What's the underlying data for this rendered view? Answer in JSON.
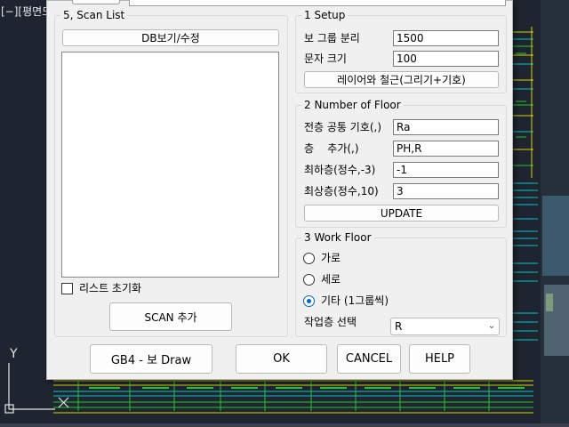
{
  "cad": {
    "viewport_label": "[−][평면도",
    "ucs_axis_label": "Y"
  },
  "scan": {
    "title": "5, Scan  List",
    "db_button": "DB보기/수정",
    "reset_checkbox_label": "리스트 초기화",
    "reset_checked": false,
    "scan_add_button": "SCAN 추가"
  },
  "setup": {
    "title": "1 Setup",
    "group_split_label": "보 그룹 분리",
    "group_split_value": "1500",
    "text_size_label": "문자 크기",
    "text_size_value": "100",
    "layer_rebar_button": "레이어와 철근(그리기+기호)"
  },
  "floors": {
    "title": "2 Number of Floor",
    "common_symbol_label": "전층 공통 기호(,)",
    "common_symbol_value": "Ra",
    "add_floor_label": "층    추가(,)",
    "add_floor_value": "PH,R",
    "lowest_label": "최하층(정수,-3)",
    "lowest_value": "-1",
    "highest_label": "최상층(정수,10)",
    "highest_value": "3",
    "update_button": "UPDATE"
  },
  "work_floor": {
    "title": "3 Work Floor",
    "options": [
      "가로",
      "세로",
      "기타 (1그룹씩)"
    ],
    "selected_index": 2,
    "select_label": "작업층 선택",
    "select_value": "R"
  },
  "footer": {
    "draw_button": "GB4 - 보 Draw",
    "ok_button": "OK",
    "cancel_button": "CANCEL",
    "help_button": "HELP"
  },
  "colors": {
    "cad_background": "#1f2530",
    "cad_line_yellow": "#d7d700",
    "cad_line_cyan": "#00c8c8",
    "cad_line_green": "#26c826",
    "accent": "#0067c0",
    "dialog_background": "#f0f0f0"
  }
}
